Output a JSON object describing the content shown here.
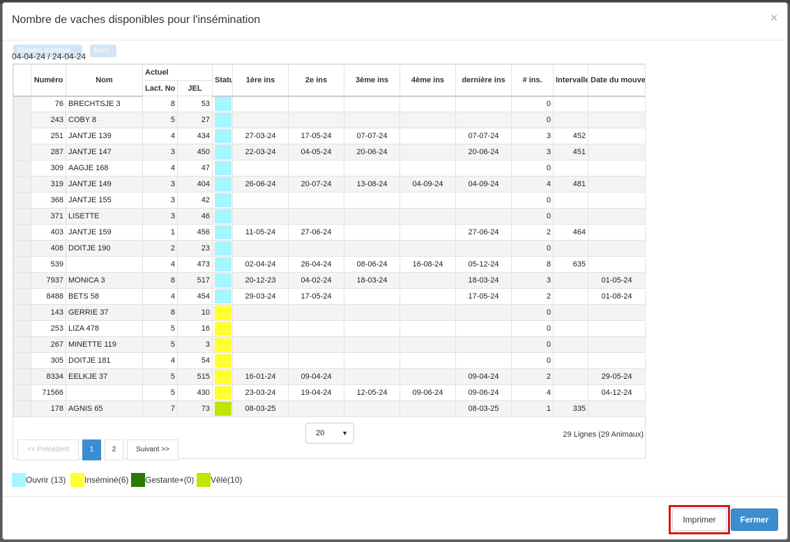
{
  "modal": {
    "title": "Nombre de vaches disponibles pour l'insémination",
    "close_symbol": "×",
    "date_range": "04-04-24 / 24-04-24",
    "drag_chips": [
      "Numéro d'animal",
      "Nom"
    ]
  },
  "table": {
    "group_header": "Actuel",
    "columns": [
      "Numéro",
      "Nom",
      "Lact. No",
      "JEL",
      "Statut",
      "1ère ins",
      "2e ins",
      "3ème ins",
      "4ème ins",
      "dernière ins",
      "# ins.",
      "Intervalle",
      "Date du mouvement"
    ],
    "rows": [
      {
        "numero": "76",
        "nom": "BRECHTSJE 3",
        "lact": "8",
        "jel": "53",
        "status": "open",
        "ins1": "",
        "ins2": "",
        "ins3": "",
        "ins4": "",
        "last": "",
        "nins": "0",
        "interval": "",
        "move": ""
      },
      {
        "numero": "243",
        "nom": "COBY 8",
        "lact": "5",
        "jel": "27",
        "status": "open",
        "ins1": "",
        "ins2": "",
        "ins3": "",
        "ins4": "",
        "last": "",
        "nins": "0",
        "interval": "",
        "move": ""
      },
      {
        "numero": "251",
        "nom": "JANTJE 139",
        "lact": "4",
        "jel": "434",
        "status": "open",
        "ins1": "27-03-24",
        "ins2": "17-05-24",
        "ins3": "07-07-24",
        "ins4": "",
        "last": "07-07-24",
        "nins": "3",
        "interval": "452",
        "move": ""
      },
      {
        "numero": "287",
        "nom": "JANTJE 147",
        "lact": "3",
        "jel": "450",
        "status": "open",
        "ins1": "22-03-24",
        "ins2": "04-05-24",
        "ins3": "20-06-24",
        "ins4": "",
        "last": "20-06-24",
        "nins": "3",
        "interval": "451",
        "move": ""
      },
      {
        "numero": "309",
        "nom": "AAGJE 168",
        "lact": "4",
        "jel": "47",
        "status": "open",
        "ins1": "",
        "ins2": "",
        "ins3": "",
        "ins4": "",
        "last": "",
        "nins": "0",
        "interval": "",
        "move": ""
      },
      {
        "numero": "319",
        "nom": "JANTJE 149",
        "lact": "3",
        "jel": "404",
        "status": "open",
        "ins1": "26-06-24",
        "ins2": "20-07-24",
        "ins3": "13-08-24",
        "ins4": "04-09-24",
        "last": "04-09-24",
        "nins": "4",
        "interval": "481",
        "move": ""
      },
      {
        "numero": "368",
        "nom": "JANTJE 155",
        "lact": "3",
        "jel": "42",
        "status": "open",
        "ins1": "",
        "ins2": "",
        "ins3": "",
        "ins4": "",
        "last": "",
        "nins": "0",
        "interval": "",
        "move": ""
      },
      {
        "numero": "371",
        "nom": "LISETTE",
        "lact": "3",
        "jel": "46",
        "status": "open",
        "ins1": "",
        "ins2": "",
        "ins3": "",
        "ins4": "",
        "last": "",
        "nins": "0",
        "interval": "",
        "move": ""
      },
      {
        "numero": "403",
        "nom": "JANTJE 159",
        "lact": "1",
        "jel": "456",
        "status": "open",
        "ins1": "11-05-24",
        "ins2": "27-06-24",
        "ins3": "",
        "ins4": "",
        "last": "27-06-24",
        "nins": "2",
        "interval": "464",
        "move": ""
      },
      {
        "numero": "408",
        "nom": "DOITJE 190",
        "lact": "2",
        "jel": "23",
        "status": "open",
        "ins1": "",
        "ins2": "",
        "ins3": "",
        "ins4": "",
        "last": "",
        "nins": "0",
        "interval": "",
        "move": ""
      },
      {
        "numero": "539",
        "nom": "",
        "lact": "4",
        "jel": "473",
        "status": "open",
        "ins1": "02-04-24",
        "ins2": "26-04-24",
        "ins3": "08-06-24",
        "ins4": "16-08-24",
        "last": "05-12-24",
        "nins": "8",
        "interval": "635",
        "move": ""
      },
      {
        "numero": "7937",
        "nom": "MONICA 3",
        "lact": "8",
        "jel": "517",
        "status": "open",
        "ins1": "20-12-23",
        "ins2": "04-02-24",
        "ins3": "18-03-24",
        "ins4": "",
        "last": "18-03-24",
        "nins": "3",
        "interval": "",
        "move": "01-05-24"
      },
      {
        "numero": "8488",
        "nom": "BETS 58",
        "lact": "4",
        "jel": "454",
        "status": "open",
        "ins1": "29-03-24",
        "ins2": "17-05-24",
        "ins3": "",
        "ins4": "",
        "last": "17-05-24",
        "nins": "2",
        "interval": "",
        "move": "01-08-24"
      },
      {
        "numero": "143",
        "nom": "GERRIE 37",
        "lact": "8",
        "jel": "10",
        "status": "inseminated",
        "ins1": "",
        "ins2": "",
        "ins3": "",
        "ins4": "",
        "last": "",
        "nins": "0",
        "interval": "",
        "move": ""
      },
      {
        "numero": "253",
        "nom": "LIZA 478",
        "lact": "5",
        "jel": "16",
        "status": "inseminated",
        "ins1": "",
        "ins2": "",
        "ins3": "",
        "ins4": "",
        "last": "",
        "nins": "0",
        "interval": "",
        "move": ""
      },
      {
        "numero": "267",
        "nom": "MINETTE 119",
        "lact": "5",
        "jel": "3",
        "status": "inseminated",
        "ins1": "",
        "ins2": "",
        "ins3": "",
        "ins4": "",
        "last": "",
        "nins": "0",
        "interval": "",
        "move": ""
      },
      {
        "numero": "305",
        "nom": "DOITJE 181",
        "lact": "4",
        "jel": "54",
        "status": "inseminated",
        "ins1": "",
        "ins2": "",
        "ins3": "",
        "ins4": "",
        "last": "",
        "nins": "0",
        "interval": "",
        "move": ""
      },
      {
        "numero": "8334",
        "nom": "EELKJE 37",
        "lact": "5",
        "jel": "515",
        "status": "inseminated",
        "ins1": "16-01-24",
        "ins2": "09-04-24",
        "ins3": "",
        "ins4": "",
        "last": "09-04-24",
        "nins": "2",
        "interval": "",
        "move": "29-05-24"
      },
      {
        "numero": "71566",
        "nom": "",
        "lact": "5",
        "jel": "430",
        "status": "inseminated",
        "ins1": "23-03-24",
        "ins2": "19-04-24",
        "ins3": "12-05-24",
        "ins4": "09-06-24",
        "last": "09-06-24",
        "nins": "4",
        "interval": "",
        "move": "04-12-24"
      },
      {
        "numero": "178",
        "nom": "AGNIS 65",
        "lact": "7",
        "jel": "73",
        "status": "calved",
        "ins1": "08-03-25",
        "ins2": "",
        "ins3": "",
        "ins4": "",
        "last": "08-03-25",
        "nins": "1",
        "interval": "335",
        "move": ""
      }
    ]
  },
  "status_colors": {
    "open": "#a6f5ff",
    "inseminated": "#ffff33",
    "pregnant": "#2a7a00",
    "calved": "#bde600"
  },
  "pagination": {
    "prev_label": "<< Précédent",
    "pages": [
      "1",
      "2"
    ],
    "current_page": "1",
    "next_label": "Suivant >>",
    "page_size": "20",
    "row_count": "29 Lignes (29 Animaux)"
  },
  "legend": [
    {
      "key": "open",
      "label": "Ouvrir (13)"
    },
    {
      "key": "inseminated",
      "label": "Inséminé(6)"
    },
    {
      "key": "pregnant",
      "label": "Gestante+(0)"
    },
    {
      "key": "calved",
      "label": "Vêlé(10)"
    }
  ],
  "footer": {
    "print_label": "Imprimer",
    "close_label": "Fermer"
  }
}
